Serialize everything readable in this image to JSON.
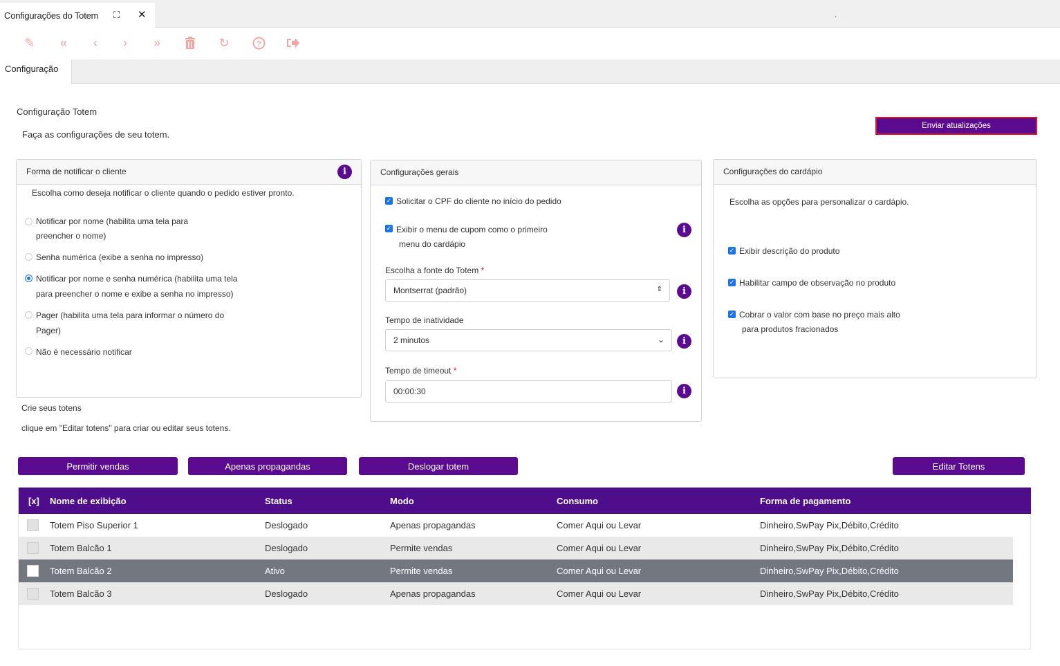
{
  "window": {
    "tab_title": "Configurações do Totem",
    "subtab": "Configuração",
    "dot": "."
  },
  "toolbar": {
    "icons": [
      "pencil-icon",
      "first-icon",
      "prev-icon",
      "next-icon",
      "last-icon",
      "trash-icon",
      "refresh-icon",
      "help-icon",
      "exit-icon"
    ]
  },
  "page": {
    "title": "Configuração Totem",
    "subtitle": "Faça as configurações de seu totem.",
    "send_button": "Enviar atualizações"
  },
  "notify": {
    "header": "Forma de notificar o cliente",
    "description": "Escolha como deseja notificar o cliente quando o pedido estiver pronto.",
    "options": [
      {
        "line1": "Notificar por nome (habilita uma tela para",
        "line2": "preencher o nome)",
        "selected": false
      },
      {
        "line1": "Senha numérica (exibe a senha no impresso)",
        "line2": "",
        "selected": false
      },
      {
        "line1": "Notificar por nome e senha numérica (habilita uma tela",
        "line2": "para preencher o nome e exibe a senha no impresso)",
        "selected": true
      },
      {
        "line1": "Pager (habilita uma tela para informar o número do",
        "line2": "Pager)",
        "selected": false
      },
      {
        "line1": "Não é necessário notificar",
        "line2": "",
        "selected": false
      }
    ]
  },
  "totems_info": {
    "title": "Crie seus totens",
    "hint": "clique em \"Editar totens\" para criar ou editar seus totens."
  },
  "general": {
    "header": "Configurações gerais",
    "cpf_label": "Solicitar o CPF do cliente no início do pedido",
    "coupon_line1": "Exibir o menu de cupom como o primeiro",
    "coupon_line2": "menu do cardápio",
    "font_label": "Escolha a fonte do Totem",
    "font_value": "Montserrat (padrão)",
    "inactivity_label": "Tempo de inatividade",
    "inactivity_value": "2 minutos",
    "timeout_label": "Tempo de timeout",
    "timeout_value": "00:00:30",
    "required_mark": "*"
  },
  "menu": {
    "header": "Configurações do cardápio",
    "description": "Escolha as opções para personalizar o cardápio.",
    "opt1": "Exibir descrição do produto",
    "opt2": "Habilitar campo de observação no produto",
    "opt3_line1": "Cobrar o valor com base no preço mais alto",
    "opt3_line2": "para produtos fracionados"
  },
  "actions": {
    "allow_sales": "Permitir vendas",
    "ads_only": "Apenas propagandas",
    "logout_totem": "Deslogar totem",
    "edit_totems": "Editar Totens"
  },
  "grid": {
    "columns": [
      "[x]",
      "Nome de exibição",
      "Status",
      "Modo",
      "Consumo",
      "Forma de pagamento"
    ],
    "rows": [
      {
        "name": "Totem Piso Superior 1",
        "status": "Deslogado",
        "mode": "Apenas propagandas",
        "consumption": "Comer Aqui ou Levar",
        "payment": "Dinheiro,SwPay Pix,Débito,Crédito"
      },
      {
        "name": "Totem Balcão 1",
        "status": "Deslogado",
        "mode": "Permite vendas",
        "consumption": "Comer Aqui ou Levar",
        "payment": "Dinheiro,SwPay Pix,Débito,Crédito"
      },
      {
        "name": "Totem Balcão 2",
        "status": "Ativo",
        "mode": "Permite vendas",
        "consumption": "Comer Aqui ou Levar",
        "payment": "Dinheiro,SwPay Pix,Débito,Crédito"
      },
      {
        "name": "Totem Balcão 3",
        "status": "Deslogado",
        "mode": "Apenas propagandas",
        "consumption": "Comer Aqui ou Levar",
        "payment": "Dinheiro,SwPay Pix,Débito,Crédito"
      }
    ]
  },
  "colors": {
    "primary": "#5a0b8f",
    "grid_header": "#4e0d8a",
    "selected_row": "#737880",
    "toolbar_icon": "#f5a3a3",
    "highlight_border": "#e0142a"
  }
}
